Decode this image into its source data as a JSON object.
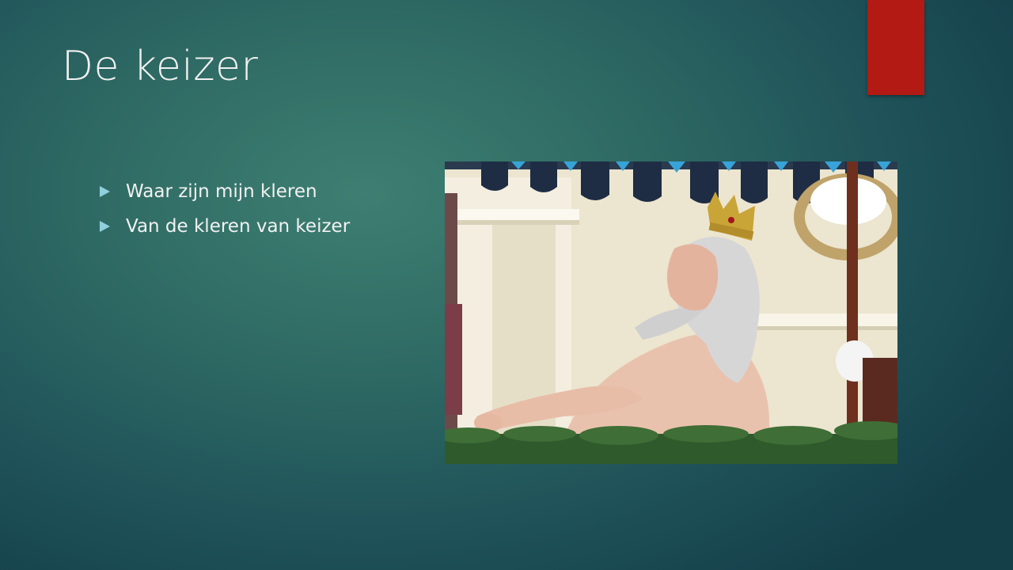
{
  "slide": {
    "title": "De keizer",
    "bullets": [
      "Waar zijn mijn kleren",
      "Van de kleren van keizer"
    ]
  },
  "colors": {
    "accent_bar": "#b31a14",
    "bullet_marker": "#8fd0dc",
    "text": "#f2f2f2",
    "background": "#2f6b64"
  },
  "image": {
    "subject": "statue-of-emperor-without-clothes"
  }
}
